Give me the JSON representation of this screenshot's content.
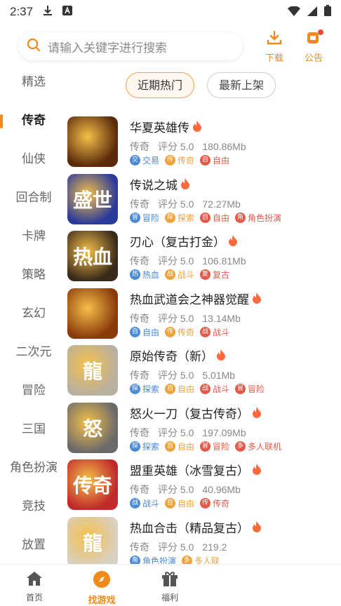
{
  "status_bar": {
    "time": "2:37"
  },
  "search": {
    "placeholder": "请输入关键字进行搜索"
  },
  "header": {
    "download_label": "下载",
    "notice_label": "公告"
  },
  "sidebar": {
    "items": [
      {
        "label": "精选",
        "active": false
      },
      {
        "label": "传奇",
        "active": true
      },
      {
        "label": "仙侠",
        "active": false
      },
      {
        "label": "回合制",
        "active": false
      },
      {
        "label": "卡牌",
        "active": false
      },
      {
        "label": "策略",
        "active": false
      },
      {
        "label": "玄幻",
        "active": false
      },
      {
        "label": "二次元",
        "active": false
      },
      {
        "label": "冒险",
        "active": false
      },
      {
        "label": "三国",
        "active": false
      },
      {
        "label": "角色扮演",
        "active": false
      },
      {
        "label": "竞技",
        "active": false
      },
      {
        "label": "放置",
        "active": false
      }
    ]
  },
  "filters": [
    {
      "label": "近期热门",
      "active": true
    },
    {
      "label": "最新上架",
      "active": false
    }
  ],
  "games": [
    {
      "name": "华夏英雄传",
      "type": "传奇",
      "rating": "评分 5.0",
      "size": "180.86Mb",
      "thumb_text": "",
      "thumb_bg": "#5a2a0a",
      "tags": [
        {
          "icon": "交",
          "label": "交易",
          "color": "#4a8ad8"
        },
        {
          "icon": "传",
          "label": "传奇",
          "color": "#f0a23a"
        },
        {
          "icon": "自",
          "label": "自由",
          "color": "#e25a4a"
        }
      ]
    },
    {
      "name": "传说之城",
      "type": "传奇",
      "rating": "评分 5.0",
      "size": "72.27Mb",
      "thumb_text": "盛世",
      "thumb_bg": "#2a3a9a",
      "tags": [
        {
          "icon": "冒",
          "label": "冒险",
          "color": "#4a8ad8"
        },
        {
          "icon": "探",
          "label": "探索",
          "color": "#f0a23a"
        },
        {
          "icon": "自",
          "label": "自由",
          "color": "#e25a4a"
        },
        {
          "icon": "角",
          "label": "角色扮演",
          "color": "#e25a4a"
        }
      ]
    },
    {
      "name": "刃心（复古打金）",
      "type": "传奇",
      "rating": "评分 5.0",
      "size": "106.81Mb",
      "thumb_text": "热血",
      "thumb_bg": "#3a2a1a",
      "tags": [
        {
          "icon": "热",
          "label": "热血",
          "color": "#4a8ad8"
        },
        {
          "icon": "战",
          "label": "战斗",
          "color": "#f0a23a"
        },
        {
          "icon": "复",
          "label": "复古",
          "color": "#e25a4a"
        }
      ]
    },
    {
      "name": "热血武道会之神器觉醒",
      "type": "传奇",
      "rating": "评分 5.0",
      "size": "13.14Mb",
      "thumb_text": "",
      "thumb_bg": "#8a3a0a",
      "tags": [
        {
          "icon": "自",
          "label": "自由",
          "color": "#4a8ad8"
        },
        {
          "icon": "传",
          "label": "传奇",
          "color": "#f0a23a"
        },
        {
          "icon": "战",
          "label": "战斗",
          "color": "#e25a4a"
        }
      ]
    },
    {
      "name": "原始传奇（新）",
      "type": "传奇",
      "rating": "评分 5.0",
      "size": "5.01Mb",
      "thumb_text": "龍",
      "thumb_bg": "#b8b0a0",
      "tags": [
        {
          "icon": "探",
          "label": "探索",
          "color": "#4a8ad8"
        },
        {
          "icon": "自",
          "label": "自由",
          "color": "#f0a23a"
        },
        {
          "icon": "战",
          "label": "战斗",
          "color": "#e25a4a"
        },
        {
          "icon": "冒",
          "label": "冒险",
          "color": "#e25a4a"
        }
      ]
    },
    {
      "name": "怒火一刀（复古传奇）",
      "type": "传奇",
      "rating": "评分 5.0",
      "size": "197.09Mb",
      "thumb_text": "怒",
      "thumb_bg": "#6a6a6a",
      "tags": [
        {
          "icon": "探",
          "label": "探索",
          "color": "#4a8ad8"
        },
        {
          "icon": "自",
          "label": "自由",
          "color": "#f0a23a"
        },
        {
          "icon": "冒",
          "label": "冒险",
          "color": "#e25a4a"
        },
        {
          "icon": "多",
          "label": "多人联机",
          "color": "#e25a4a"
        }
      ]
    },
    {
      "name": "盟重英雄（冰雪复古）",
      "type": "传奇",
      "rating": "评分 5.0",
      "size": "40.96Mb",
      "thumb_text": "传奇",
      "thumb_bg": "#c02a2a",
      "tags": [
        {
          "icon": "战",
          "label": "战斗",
          "color": "#4a8ad8"
        },
        {
          "icon": "自",
          "label": "自由",
          "color": "#f0a23a"
        },
        {
          "icon": "传",
          "label": "传奇",
          "color": "#e25a4a"
        }
      ]
    },
    {
      "name": "热血合击（精品复古）",
      "type": "传奇",
      "rating": "评分 5.0",
      "size": "219.2",
      "thumb_text": "龍",
      "thumb_bg": "#d8d0c0",
      "tags": [
        {
          "icon": "角",
          "label": "角色扮演",
          "color": "#4a8ad8"
        },
        {
          "icon": "多",
          "label": "多人联",
          "color": "#f0a23a"
        }
      ]
    }
  ],
  "bottom_nav": [
    {
      "label": "首页",
      "active": false
    },
    {
      "label": "找游戏",
      "active": true
    },
    {
      "label": "福利",
      "active": false
    }
  ],
  "colors": {
    "accent": "#f08a1c",
    "fire": "#ff6a3d"
  }
}
